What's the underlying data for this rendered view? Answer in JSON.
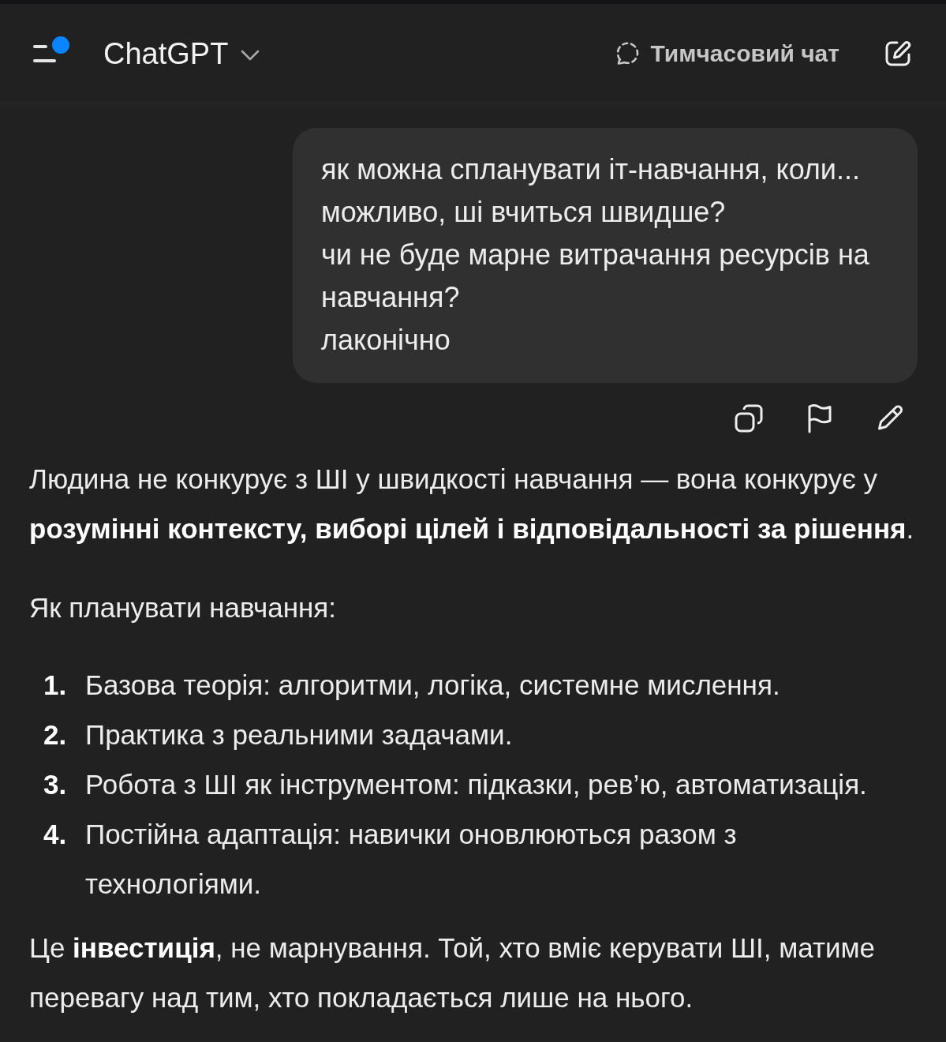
{
  "header": {
    "menu": {
      "notification": true
    },
    "model_selector": {
      "label": "ChatGPT"
    },
    "temporary_chat": {
      "label": "Тимчасовий чат"
    }
  },
  "user_message": {
    "text": "як можна спланувати іт-навчання, коли...\nможливо, ші вчиться швидше?\nчи не буде марне витрачання ресурсів на навчання?\nлаконічно"
  },
  "assistant_message": {
    "blocks": [
      {
        "kind": "paragraph",
        "text": "Людина не конкурує з ШІ у швидкості навчання — вона конкурує у **розумінні контексту, виборі цілей і відповідальності за рішення**."
      },
      {
        "kind": "paragraph",
        "text": "Як планувати навчання:"
      },
      {
        "kind": "list",
        "items": [
          {
            "number": "1.",
            "text": "Базова теорія: алгоритми, логіка, системне мислення."
          },
          {
            "number": "2.",
            "text": "Практика з реальними задачами."
          },
          {
            "number": "3.",
            "text": "Робота з ШІ як інструментом: підказки, рев’ю, автоматизація."
          },
          {
            "number": "4.",
            "text": "Постійна адаптація: навички оновлюються разом з технологіями."
          }
        ]
      },
      {
        "kind": "paragraph",
        "text": "Це **інвестиція**, не марнування. Той, хто вміє керувати ШІ, матиме перевагу над тим, хто покладається лише на нього."
      }
    ]
  }
}
